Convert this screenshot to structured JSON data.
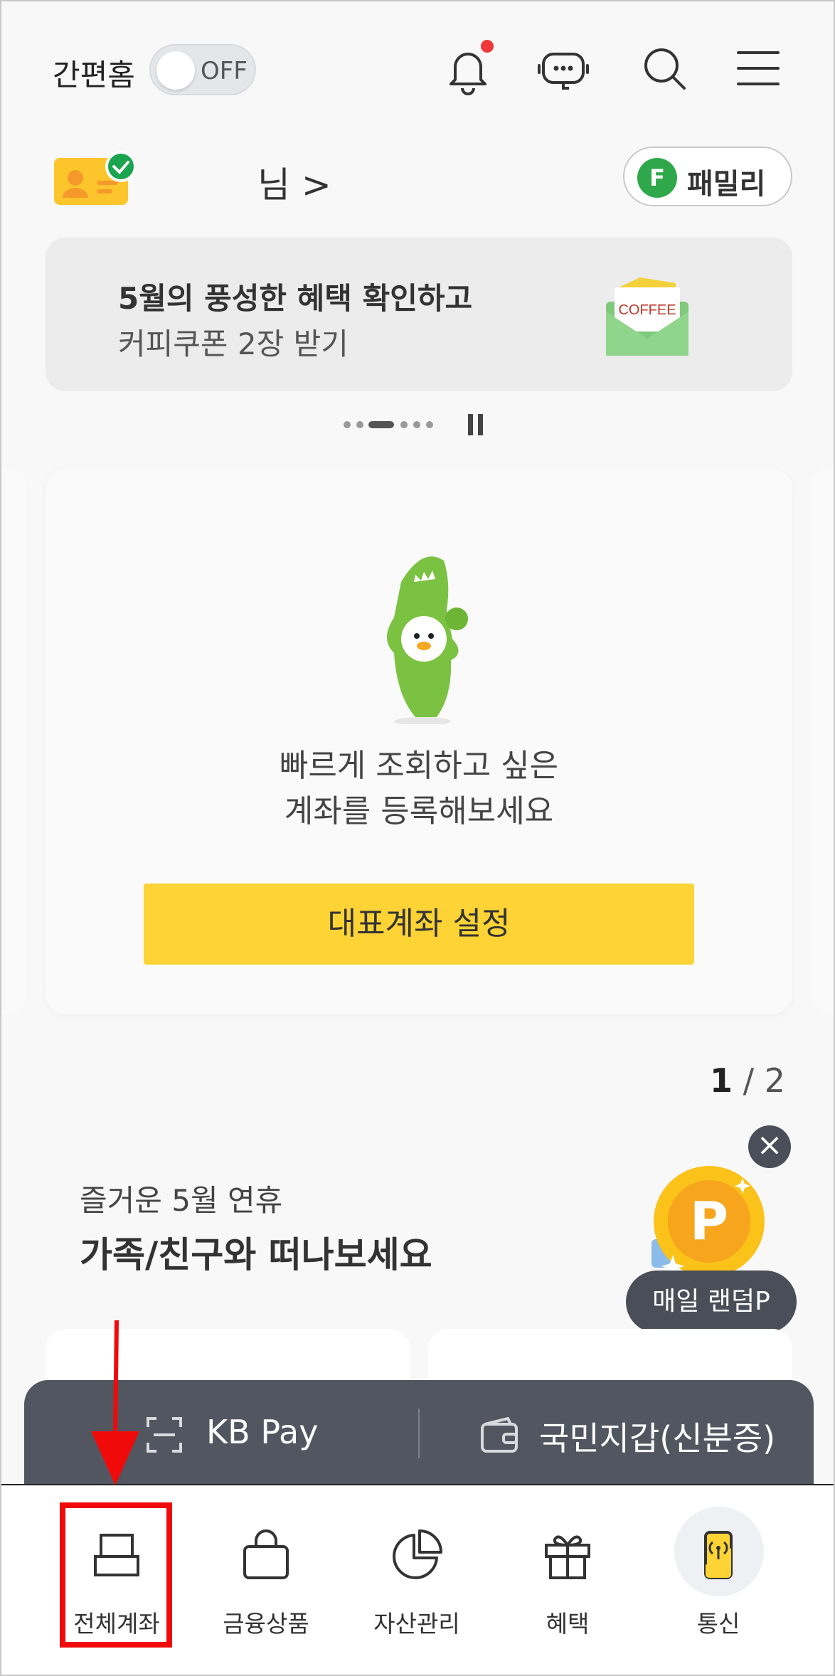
{
  "header": {
    "easy_home_label": "간편홈",
    "toggle_state": "OFF",
    "icons": [
      "bell-icon",
      "chatbot-icon",
      "search-icon",
      "menu-icon"
    ],
    "notification_dot_color": "#f0383a"
  },
  "profile": {
    "name_suffix": "님 >",
    "family_badge_letter": "F",
    "family_label": "패밀리"
  },
  "banner": {
    "line1": "5월의 풍성한 혜택 확인하고",
    "line2": "커피쿠폰 2장 받기",
    "envelope_text": "COFFEE"
  },
  "account_card": {
    "text_line1": "빠르게 조회하고 싶은",
    "text_line2": "계좌를 등록해보세요",
    "button_label": "대표계좌 설정",
    "button_color": "#fdd335"
  },
  "page_indicator": {
    "current": "1",
    "separator": " / ",
    "total": "2"
  },
  "promo": {
    "subtitle": "즐거운 5월 연휴",
    "title": "가족/친구와 떠나보세요",
    "coin_letter": "P",
    "random_point_label": "매일 랜덤P"
  },
  "paybar": {
    "left_label": "KB Pay",
    "right_label": "국민지갑(신분증)"
  },
  "bottom_nav": {
    "items": [
      {
        "label": "전체계좌",
        "icon": "account-book-icon"
      },
      {
        "label": "금융상품",
        "icon": "shopping-bag-icon"
      },
      {
        "label": "자산관리",
        "icon": "pie-chart-icon"
      },
      {
        "label": "혜택",
        "icon": "gift-icon"
      },
      {
        "label": "통신",
        "icon": "phone-signal-icon"
      }
    ]
  },
  "colors": {
    "brand_yellow": "#fdd335",
    "dark_bar": "#525660",
    "annotation_red": "#f00a0a"
  }
}
